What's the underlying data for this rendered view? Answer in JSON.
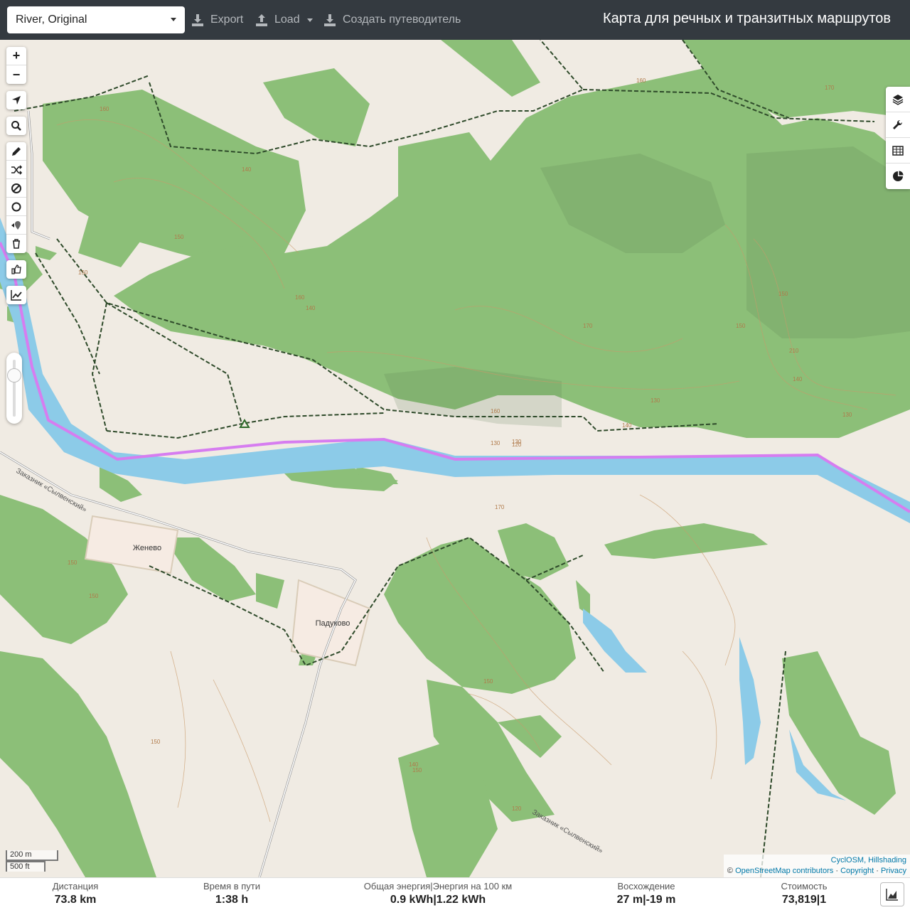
{
  "topbar": {
    "profile": "River, Original",
    "export_label": "Export",
    "load_label": "Load",
    "guide_label": "Создать путеводитель",
    "title": "Карта для речных и транзитных маршрутов"
  },
  "map": {
    "places": [
      {
        "name": "Женево"
      },
      {
        "name": "Падуково"
      }
    ],
    "reserve_label": "Заказник «Сылвенский»",
    "contours": [
      "160",
      "140",
      "150",
      "150",
      "160",
      "140",
      "160",
      "170",
      "140",
      "130",
      "130",
      "150",
      "150",
      "170",
      "160",
      "140",
      "150",
      "150",
      "170",
      "150",
      "130",
      "210",
      "120",
      "140",
      "120",
      "150",
      "130",
      "150"
    ]
  },
  "left_controls": {
    "zoom_in": "+",
    "zoom_out": "−",
    "icons": [
      "locate-icon",
      "search-icon",
      "pencil-icon",
      "shuffle-icon",
      "no-entry-icon",
      "circle-icon",
      "pin-icon",
      "trash-icon",
      "thumb-icon",
      "chart-icon"
    ]
  },
  "right_controls": {
    "icons": [
      "layers-icon",
      "wrench-icon",
      "table-icon",
      "pie-chart-icon"
    ]
  },
  "scale": {
    "metric": "200 m",
    "imperial": "500 ft"
  },
  "attribution": {
    "line1": "CyclOSM, Hillshading",
    "copyright_symbol": "©",
    "osm": "OpenStreetMap contributors",
    "sep1": "·",
    "copyright": "Copyright",
    "sep2": "·",
    "privacy": "Privacy"
  },
  "stats": {
    "distance": {
      "label": "Дистанция",
      "value": "73.8 km"
    },
    "time": {
      "label": "Время в пути",
      "value": "1:38 h"
    },
    "energy": {
      "label": "Общая энергия|Энергия на 100 км",
      "value": "0.9 kWh|1.22 kWh"
    },
    "ascent": {
      "label": "Восхождение",
      "value": "27 m|-19 m"
    },
    "cost": {
      "label": "Стоимость",
      "value": "73,819|1"
    }
  },
  "colors": {
    "forest": "#8cbf78",
    "water": "#8ccbe8",
    "route": "#d67df0",
    "land": "#f0ebe3",
    "path": "#2e4a2a",
    "navbar": "#343a40"
  }
}
